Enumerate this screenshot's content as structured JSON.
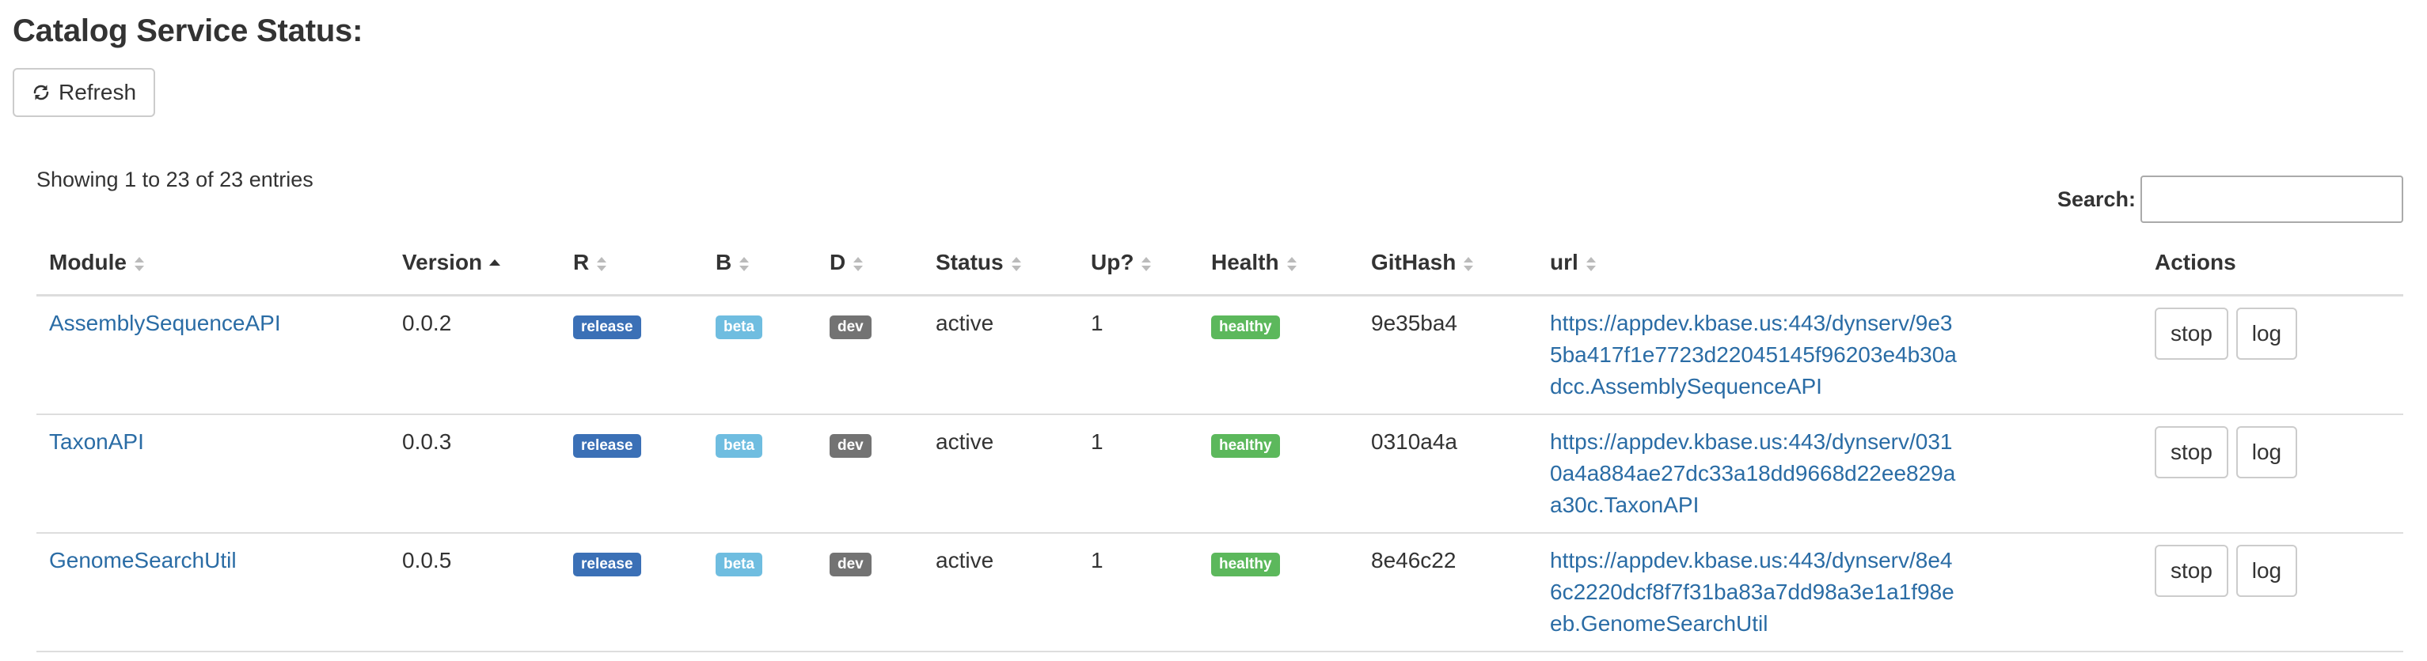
{
  "page": {
    "title": "Catalog Service Status:",
    "refresh_label": "Refresh",
    "info": "Showing 1 to 23 of 23 entries",
    "search_label": "Search:",
    "search_value": ""
  },
  "columns": {
    "module": "Module",
    "version": "Version",
    "r": "R",
    "b": "B",
    "d": "D",
    "status": "Status",
    "up": "Up?",
    "health": "Health",
    "githash": "GitHash",
    "url": "url",
    "actions": "Actions"
  },
  "sort": {
    "column": "Version",
    "direction": "ascending"
  },
  "rows": [
    {
      "module": "AssemblySequenceAPI",
      "version": "0.0.2",
      "r": "release",
      "b": "beta",
      "d": "dev",
      "status": "active",
      "up": "1",
      "health": "healthy",
      "githash": "9e35ba4",
      "url": "https://appdev.kbase.us:443/dynserv/9e35ba417f1e7723d22045145f96203e4b30adcc.AssemblySequenceAPI",
      "stop": "stop",
      "log": "log"
    },
    {
      "module": "TaxonAPI",
      "version": "0.0.3",
      "r": "release",
      "b": "beta",
      "d": "dev",
      "status": "active",
      "up": "1",
      "health": "healthy",
      "githash": "0310a4a",
      "url": "https://appdev.kbase.us:443/dynserv/0310a4a884ae27dc33a18dd9668d22ee829aa30c.TaxonAPI",
      "stop": "stop",
      "log": "log"
    },
    {
      "module": "GenomeSearchUtil",
      "version": "0.0.5",
      "r": "release",
      "b": "beta",
      "d": "dev",
      "status": "active",
      "up": "1",
      "health": "healthy",
      "githash": "8e46c22",
      "url": "https://appdev.kbase.us:443/dynserv/8e46c2220dcf8f7f31ba83a7dd98a3e1a1f98eeb.GenomeSearchUtil",
      "stop": "stop",
      "log": "log"
    }
  ],
  "colors": {
    "link": "#2a6ca5",
    "release": "#3b70b6",
    "beta": "#6fbde0",
    "dev": "#737373",
    "healthy": "#5cb85c"
  }
}
